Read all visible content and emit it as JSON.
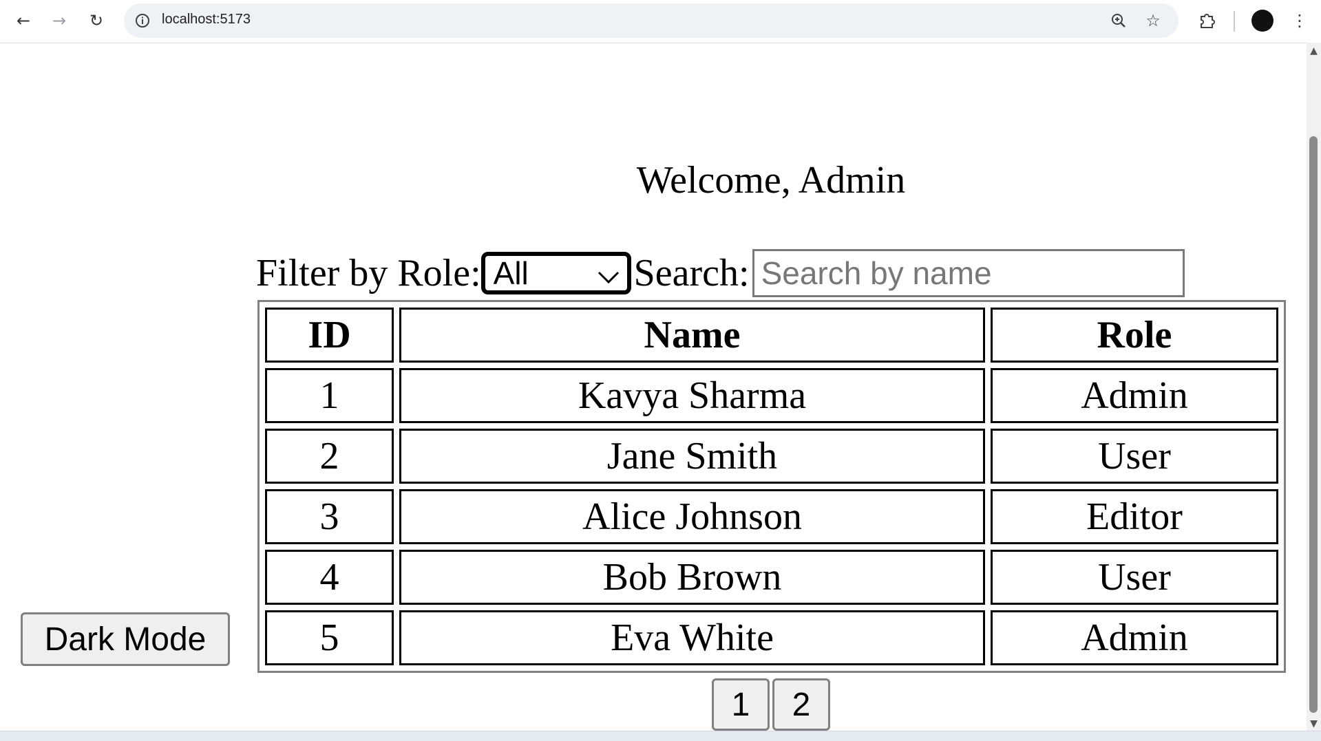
{
  "browser": {
    "url": "localhost:5173",
    "icons": {
      "back": "arrow-left-icon",
      "forward": "arrow-right-icon",
      "reload": "reload-icon",
      "site_info": "info-icon",
      "zoom": "zoom-icon",
      "bookmark": "star-icon",
      "extensions": "puzzle-icon",
      "profile": "avatar",
      "menu": "kebab-menu-icon"
    }
  },
  "page": {
    "welcome": "Welcome, Admin",
    "filter_label": "Filter by Role:",
    "role_selected": "All",
    "search_label": "Search:",
    "search_placeholder": "Search by name",
    "search_value": "",
    "table": {
      "headers": [
        "ID",
        "Name",
        "Role"
      ],
      "rows": [
        [
          "1",
          "Kavya Sharma",
          "Admin"
        ],
        [
          "2",
          "Jane Smith",
          "User"
        ],
        [
          "3",
          "Alice Johnson",
          "Editor"
        ],
        [
          "4",
          "Bob Brown",
          "User"
        ],
        [
          "5",
          "Eva White",
          "Admin"
        ]
      ]
    },
    "pagination": [
      "1",
      "2"
    ],
    "dark_mode_label": "Dark Mode"
  }
}
